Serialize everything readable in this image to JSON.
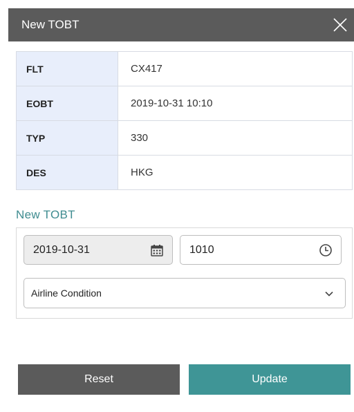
{
  "dialog": {
    "title": "New TOBT"
  },
  "flight_info": [
    {
      "key": "FLT",
      "value": "CX417"
    },
    {
      "key": "EOBT",
      "value": "2019-10-31 10:10"
    },
    {
      "key": "TYP",
      "value": "330"
    },
    {
      "key": "DES",
      "value": "HKG"
    }
  ],
  "form": {
    "section_title": "New TOBT",
    "date_value": "2019-10-31",
    "time_value": "1010",
    "condition_value": "Airline Condition"
  },
  "buttons": {
    "reset_label": "Reset",
    "update_label": "Update"
  },
  "icons": {
    "close": "close-icon",
    "date": "calendar-icon",
    "time": "clock-icon",
    "dropdown": "chevron-down-icon"
  },
  "colors": {
    "header_bg": "#5b5b5b",
    "key_cell_bg": "#e8eefb",
    "accent": "#3f9596",
    "section_title": "#3f8c90"
  }
}
